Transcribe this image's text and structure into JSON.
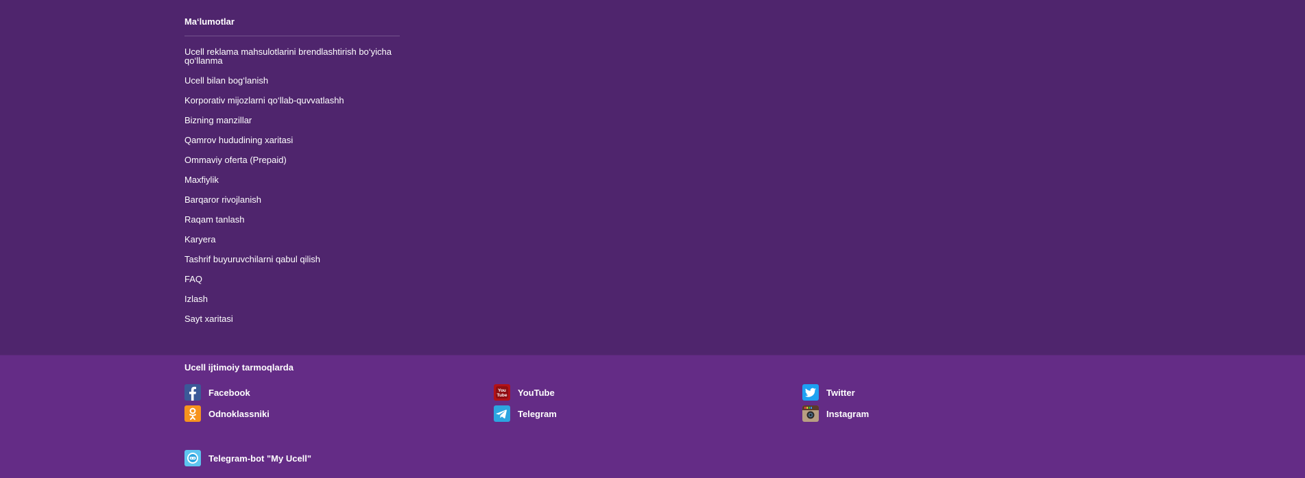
{
  "info": {
    "title": "Ma‘lumotlar",
    "links": [
      "Ucell reklama mahsulotlarini brendlashtirish bo‘yicha qo‘llanma",
      "Ucell bilan bog‘lanish",
      "Korporativ mijozlarni qo‘llab-quvvatlashh",
      "Bizning manzillar",
      "Qamrov hududining xaritasi",
      "Ommaviy oferta (Prepaid)",
      "Maxfiylik",
      "Barqaror rivojlanish",
      "Raqam tanlash",
      "Karyera",
      "Tashrif buyuruvchilarni qabul qilish",
      "FAQ",
      "Izlash",
      "Sayt xaritasi"
    ]
  },
  "social": {
    "title": "Ucell ijtimoiy tarmoqlarda",
    "items": {
      "facebook": "Facebook",
      "youtube": "YouTube",
      "twitter": "Twitter",
      "odnoklassniki": "Odnoklassniki",
      "telegram": "Telegram",
      "instagram": "Instagram",
      "telegram_bot": "Telegram-bot \"My Ucell\""
    }
  },
  "colors": {
    "info_bg": "#4f256d",
    "social_bg": "#642c86",
    "facebook": "#3b5998",
    "youtube": "#b31217",
    "twitter": "#1da1f2",
    "odnoklassniki": "#f7931e",
    "telegram": "#2ca5e0",
    "instagram": "#b89f82"
  }
}
